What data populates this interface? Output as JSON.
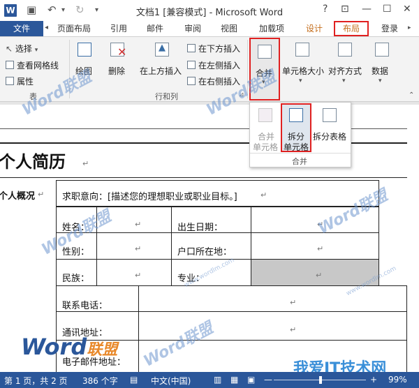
{
  "titlebar": {
    "title": "文档1 [兼容模式] - Microsoft Word",
    "help": "?",
    "minimize": "—",
    "restore": "☐",
    "close": "✕",
    "app_icon": "W"
  },
  "tabs": {
    "file": "文件",
    "page_layout": "页面布局",
    "references": "引用",
    "mailings": "邮件",
    "review": "审阅",
    "view": "视图",
    "addins": "加载项",
    "design": "设计",
    "layout": "布局",
    "signin": "登录"
  },
  "ribbon": {
    "select": "选择",
    "view_gridlines": "查看网格线",
    "properties": "属性",
    "draw": "绘图",
    "delete": "删除",
    "insert_above": "在上方插入",
    "insert_below": "在下方插入",
    "insert_left": "在左侧插入",
    "insert_right": "在右侧插入",
    "merge": "合并",
    "cell_size": "单元格大小",
    "alignment": "对齐方式",
    "data": "数据",
    "group_table": "表",
    "group_rows_cols": "行和列"
  },
  "dropdown": {
    "merge_cells_1": "合并",
    "merge_cells_2": "单元格",
    "split_cells_1": "拆分",
    "split_cells_2": "单元格",
    "split_table": "拆分表格",
    "group_label": "合并"
  },
  "document": {
    "heading": "个人简历",
    "section": "个人概况",
    "objective": "求职意向：[描述您的理想职业或职业目标。]",
    "name_label": "姓名：",
    "birth_label": "出生日期：",
    "gender_label": "性别：",
    "hukou_label": "户口所在地：",
    "ethnicity_label": "民族：",
    "major_label": "专业：",
    "phone_label": "联系电话：",
    "address_label": "通讯地址：",
    "email_label": "电子邮件地址：",
    "para_mark": "↵",
    "watermark_word": "Word",
    "watermark_lm": "联盟",
    "watermark_site": "www.wordlm.com",
    "corner_logo_word": "Word",
    "corner_logo_lm": "联盟",
    "corner_site_logo": "我爱IT技术网"
  },
  "status": {
    "page": "第 1 页，共 2 页",
    "words": "386 个字",
    "language": "中文(中国)",
    "zoom": "99%",
    "zoom_minus": "—",
    "zoom_plus": "+"
  },
  "colors": {
    "accent": "#2b579a",
    "highlight": "#e02020",
    "context_tab": "#c46c1a",
    "shaded_cell": "#c8c8c8"
  }
}
